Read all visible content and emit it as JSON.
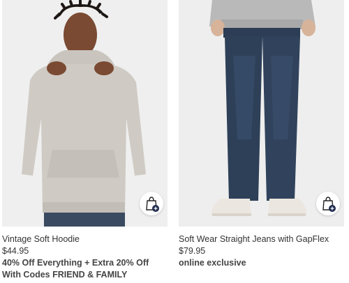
{
  "products": [
    {
      "name": "Vintage Soft Hoodie",
      "price": "$44.95",
      "promo_line1": "40% Off Everything + Extra 20% Off",
      "promo_line2": "With Codes FRIEND & FAMILY",
      "image_icon": "hoodie-photo",
      "quick_add_icon": "shopping-bag-plus-icon"
    },
    {
      "name": "Soft Wear Straight Jeans with GapFlex",
      "price": "$79.95",
      "promo_line1": "online exclusive",
      "image_icon": "jeans-photo",
      "quick_add_icon": "shopping-bag-plus-icon"
    }
  ],
  "colors": {
    "hoodie": "#cfcbc4",
    "denim": "#2e4058",
    "shoe": "#ebe6df",
    "badge": "#1f2b4d"
  }
}
